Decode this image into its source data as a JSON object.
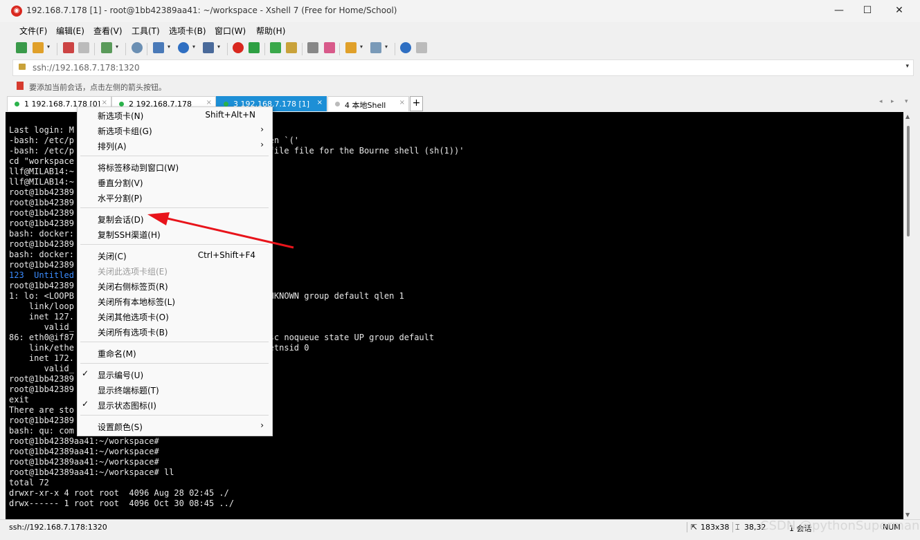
{
  "window": {
    "title": "192.168.7.178 [1] - root@1bb42389aa41: ~/workspace - Xshell 7 (Free for Home/School)",
    "app_icon": "xshell-icon",
    "minimize": "—",
    "maximize": "☐",
    "close": "✕"
  },
  "menu": [
    "文件(F)",
    "编辑(E)",
    "查看(V)",
    "工具(T)",
    "选项卡(B)",
    "窗口(W)",
    "帮助(H)"
  ],
  "address": {
    "value": "ssh://192.168.7.178:1320",
    "dropdown": "▾"
  },
  "hint": {
    "text": "要添加当前会话，点击左侧的箭头按钮。"
  },
  "tabs": [
    {
      "label": "1 192.168.7.178 [0]",
      "active": false
    },
    {
      "label": "2 192.168.7.178",
      "active": false
    },
    {
      "label": "3 192.168.7.178 [1]",
      "active": true
    },
    {
      "label": "4 本地Shell",
      "active": false
    }
  ],
  "tab_add": "+",
  "tab_close": "×",
  "terminal": {
    "lines": [
      "Last login: M                                  0",
      "-bash: /etc/p                                ted token `('",
      "-bash: /etc/p                                de .profile file for the Bourne shell (sh(1))'",
      "cd \"workspace",
      "llf@MILAB14:~",
      "llf@MILAB14:~",
      "root@1bb42389                                f",
      "root@1bb42389",
      "root@1bb42389",
      "root@1bb42389",
      "bash: docker:",
      "root@1bb42389",
      "bash: docker:",
      "root@1bb42389",
      "123  Untitled",
      "root@1bb42389",
      "1: lo: <LOOPB                                state UNKNOWN group default qlen 1",
      "    link/loop                                :00",
      "    inet 127.",
      "       valid_",
      "86: eth0@if87                                500 qdisc noqueue state UP group default",
      "    link/ethe                                 link-netnsid 0",
      "    inet 172.                                 eth0",
      "       valid_",
      "root@1bb42389",
      "root@1bb42389",
      "exit",
      "There are sto",
      "root@1bb42389",
      "bash: qu: com",
      "root@1bb42389aa41:~/workspace#",
      "root@1bb42389aa41:~/workspace#",
      "root@1bb42389aa41:~/workspace#",
      "root@1bb42389aa41:~/workspace# ll",
      "total 72",
      "drwxr-xr-x 4 root root  4096 Aug 28 02:45 ./",
      "drwx------ 1 root root  4096 Oct 30 08:45 ../"
    ],
    "highlight_line_index": 14
  },
  "context_menu": {
    "items": [
      {
        "label": "新选项卡(N)",
        "shortcut": "Shift+Alt+N"
      },
      {
        "label": "新选项卡组(G)",
        "submenu": "›"
      },
      {
        "label": "排列(A)",
        "submenu": "›"
      },
      {
        "separator": true
      },
      {
        "label": "将标签移动到窗口(W)"
      },
      {
        "label": "垂直分割(V)"
      },
      {
        "label": "水平分割(P)"
      },
      {
        "separator": true
      },
      {
        "label": "复制会话(D)"
      },
      {
        "label": "复制SSH渠道(H)"
      },
      {
        "separator": true
      },
      {
        "label": "关闭(C)",
        "shortcut": "Ctrl+Shift+F4"
      },
      {
        "label": "关闭此选项卡组(E)",
        "disabled": true
      },
      {
        "label": "关闭右侧标签页(R)"
      },
      {
        "label": "关闭所有本地标签(L)"
      },
      {
        "label": "关闭其他选项卡(O)"
      },
      {
        "label": "关闭所有选项卡(B)"
      },
      {
        "separator": true
      },
      {
        "label": "重命名(M)"
      },
      {
        "separator": true
      },
      {
        "label": "显示编号(U)",
        "checked": "✓"
      },
      {
        "label": "显示终端标题(T)"
      },
      {
        "label": "显示状态图标(I)",
        "checked": "✓"
      },
      {
        "separator": true
      },
      {
        "label": "设置颜色(S)",
        "submenu": "›"
      }
    ]
  },
  "status": {
    "connection": "ssh://192.168.7.178:1320",
    "size": "183x38",
    "cursor": "38,32",
    "sessions": "1 会话",
    "num": "NUM"
  },
  "watermark": "CSDN @pythonSuperman",
  "colors": {
    "active_tab": "#1d8fd6",
    "terminal_bg": "#000000",
    "annotation_arrow": "#e8141b"
  }
}
